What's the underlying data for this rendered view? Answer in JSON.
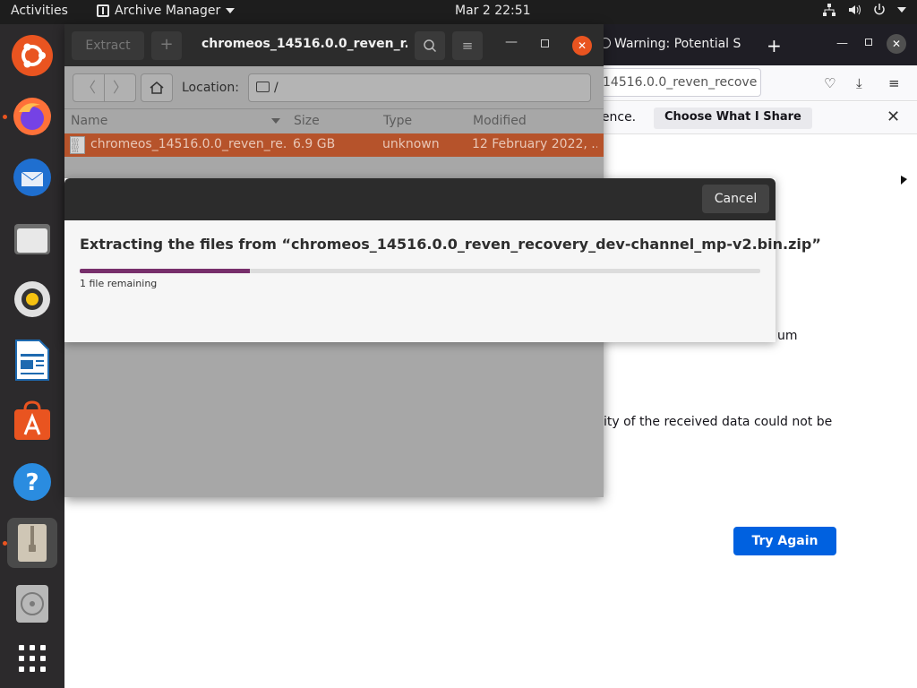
{
  "topbar": {
    "activities": "Activities",
    "app_name": "Archive Manager",
    "clock": "Mar 2  22:51",
    "tray_icons": [
      "network-icon",
      "volume-icon",
      "power-icon"
    ]
  },
  "dock": {
    "items": [
      "ubuntu-software-center-icon",
      "firefox-icon",
      "thunderbird-icon",
      "files-icon",
      "rhythmbox-icon",
      "libreoffice-writer-icon",
      "ubuntu-software-icon",
      "help-icon",
      "archive-manager-icon",
      "disk-icon",
      "show-apps-icon"
    ]
  },
  "firefox": {
    "tab_title": "Warning: Potential S",
    "url": "14516.0.0_reven_recove",
    "notification_text": "ience.",
    "share_button": "Choose What I Share",
    "body_text_1": "um",
    "body_text_2": "ity of the received data could not be",
    "try_again": "Try Again"
  },
  "archive_manager": {
    "extract_label": "Extract",
    "title": "chromeos_14516.0.0_reven_r...",
    "location_label": "Location:",
    "location_value": "/",
    "columns": {
      "name": "Name",
      "size": "Size",
      "type": "Type",
      "modified": "Modified"
    },
    "files": [
      {
        "name": "chromeos_14516.0.0_reven_re...",
        "size": "6.9 GB",
        "type": "unknown",
        "modified": "12 February 2022, ..."
      }
    ]
  },
  "dialog": {
    "cancel": "Cancel",
    "title": "Extracting the files from “chromeos_14516.0.0_reven_recovery_dev-channel_mp-v2.bin.zip”",
    "progress_fraction": 0.25,
    "remaining": "1 file remaining"
  },
  "colors": {
    "accent": "#e95420",
    "progress": "#772f6b",
    "selection": "#b6532b",
    "firefox_blue": "#0061e0"
  }
}
